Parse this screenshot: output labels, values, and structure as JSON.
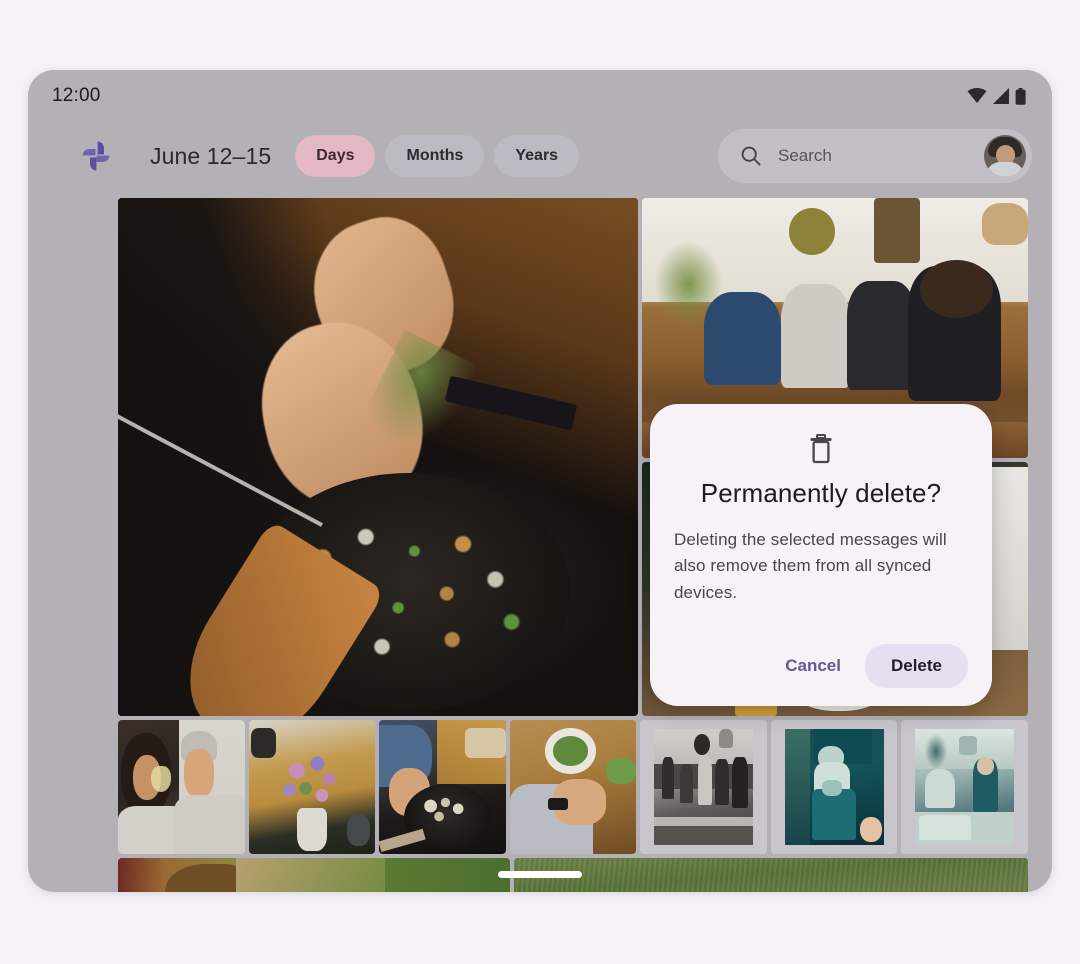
{
  "theme": {
    "page_background": "#f4f2f7",
    "device_frame": "#b3b1b6",
    "chip_selected_bg": "#e4b9c4",
    "chip_bg": "#bcbac2",
    "search_bg": "#c2c0c6",
    "dialog_bg": "#f7f1f8",
    "dialog_accent_text": "#605a95",
    "delete_button_bg": "#e6dff0",
    "logo_purple": "#5b4e9e"
  },
  "status_bar": {
    "time": "12:00",
    "icons": [
      "wifi-icon",
      "cellular-signal-icon",
      "battery-icon"
    ]
  },
  "app_bar": {
    "logo_icon": "google-photos-pinwheel-icon",
    "date_range": "June 12–15",
    "chips": [
      {
        "label": "Days",
        "selected": true
      },
      {
        "label": "Months",
        "selected": false
      },
      {
        "label": "Years",
        "selected": false
      }
    ],
    "search": {
      "icon": "search-icon",
      "placeholder": "Search",
      "value": ""
    },
    "avatar": "account-avatar"
  },
  "photo_grid": {
    "hero": {
      "name": "photo-cooking-mushrooms"
    },
    "right_column": [
      {
        "name": "photo-group-on-sofa"
      },
      {
        "name": "photo-dinner-table"
      }
    ],
    "thumbnails": [
      {
        "name": "photo-couple-drinking",
        "style": "plain"
      },
      {
        "name": "photo-flower-bouquet",
        "style": "plain"
      },
      {
        "name": "photo-skillet-cooking",
        "style": "plain"
      },
      {
        "name": "photo-table-from-above",
        "style": "plain"
      },
      {
        "name": "photo-bw-group-portrait",
        "style": "polaroid"
      },
      {
        "name": "photo-teal-person-seated",
        "style": "polaroid"
      },
      {
        "name": "photo-teal-living-room",
        "style": "polaroid"
      }
    ],
    "bottom_strip": [
      {
        "name": "photo-path-field"
      },
      {
        "name": "photo-grass-field"
      }
    ]
  },
  "dialog": {
    "icon": "trash-can-icon",
    "title": "Permanently delete?",
    "body": "Deleting the selected messages will also remove them from all synced devices.",
    "cancel_label": "Cancel",
    "confirm_label": "Delete"
  },
  "navigation": {
    "gesture_pill": "home-gesture-indicator"
  }
}
